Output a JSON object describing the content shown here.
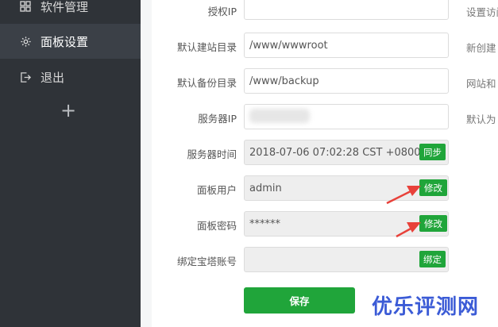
{
  "sidebar": {
    "items": [
      {
        "label": "软件管理",
        "icon": "grid-icon"
      },
      {
        "label": "面板设置",
        "icon": "gear-icon"
      },
      {
        "label": "退出",
        "icon": "logout-icon"
      }
    ],
    "add_symbol": "+"
  },
  "form": {
    "auth_ip": {
      "label": "授权IP",
      "value": "",
      "hint": "设置访问"
    },
    "site_dir": {
      "label": "默认建站目录",
      "value": "/www/wwwroot",
      "hint": "新创建"
    },
    "backup_dir": {
      "label": "默认备份目录",
      "value": "/www/backup",
      "hint": "网站和"
    },
    "server_ip": {
      "label": "服务器IP",
      "value": "",
      "hint": "默认为"
    },
    "server_time": {
      "label": "服务器时间",
      "value": "2018-07-06 07:02:28 CST +0800",
      "button": "同步"
    },
    "panel_user": {
      "label": "面板用户",
      "value": "admin",
      "button": "修改"
    },
    "panel_password": {
      "label": "面板密码",
      "value": "******",
      "button": "修改"
    },
    "bt_account": {
      "label": "绑定宝塔账号",
      "value": "",
      "button": "绑定"
    },
    "save_label": "保存"
  },
  "watermark": "优乐评测网",
  "colors": {
    "accent": "#20a53a",
    "sidebar_bg": "#2f3338",
    "arrow": "#e8413a",
    "watermark": "#3b5bd6"
  }
}
